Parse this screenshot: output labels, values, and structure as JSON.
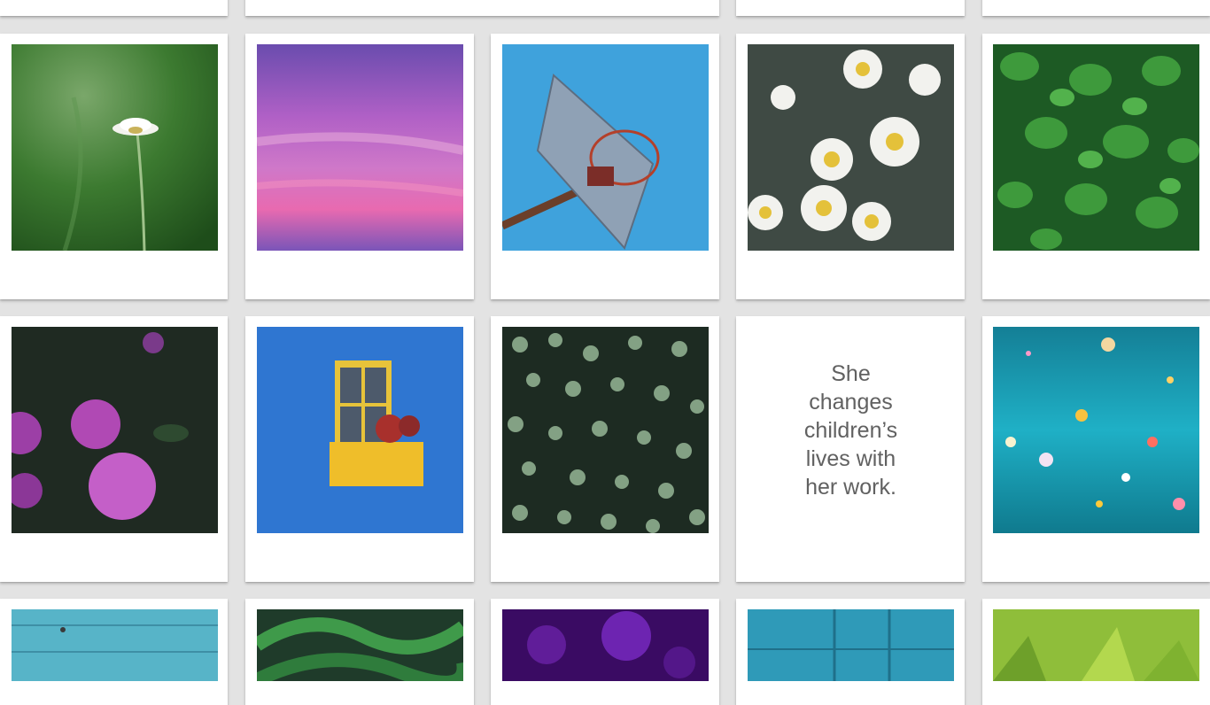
{
  "gallery": {
    "quote_card": {
      "text": "She changes children’s lives with her work."
    },
    "images": [
      "daisy-single-green-field",
      "purple-pink-sunset-sky",
      "basketball-hoop-blue-sky",
      "white-daisies-cluster",
      "green-leaves-foliage",
      "purple-roses-dark",
      "blue-wall-yellow-window-planter",
      "small-round-leaves-vine",
      "teal-confetti-bokeh",
      "blue-wooden-planks",
      "green-fern-fronds",
      "purple-bokeh",
      "teal-wooden-door",
      "green-grass-closeup"
    ]
  }
}
